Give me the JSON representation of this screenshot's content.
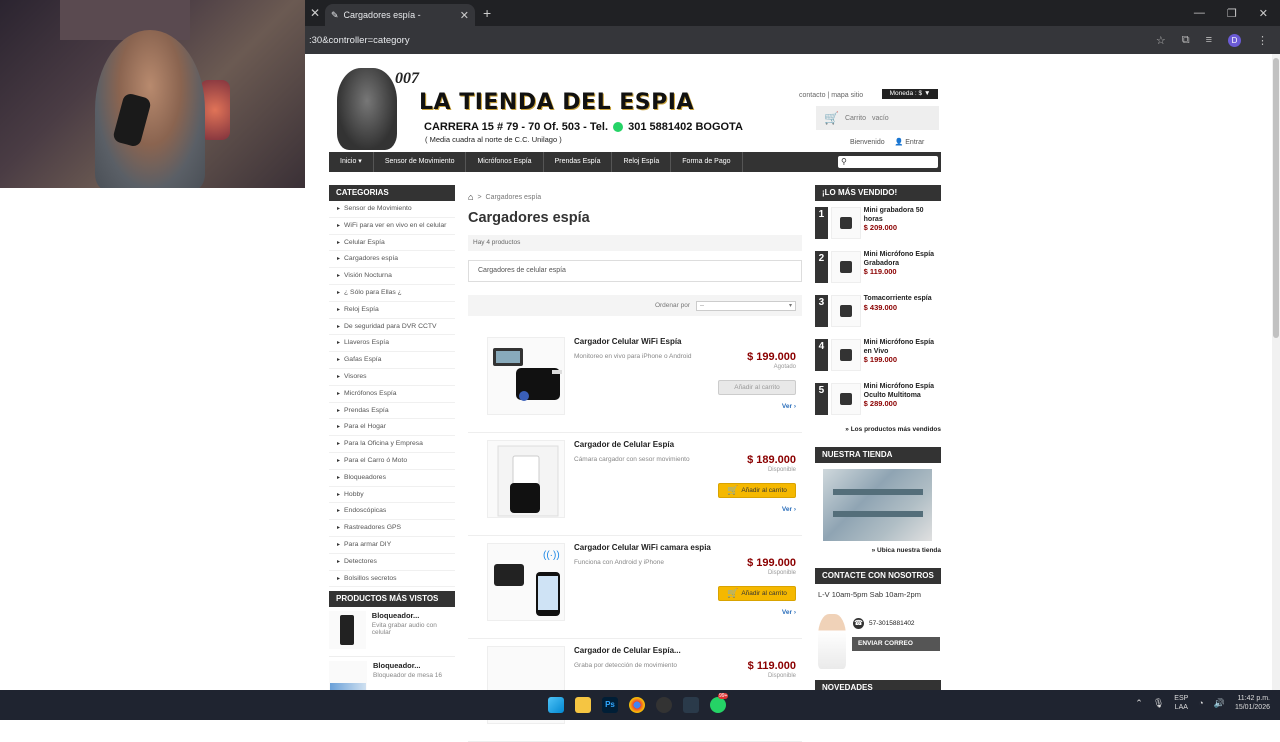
{
  "browser": {
    "tab_title": "Cargadores espía -",
    "url": ":30&controller=category",
    "profile_initial": "D"
  },
  "header": {
    "logo_007": "007",
    "logo_title": "LA TIENDA DEL ESPIA",
    "address_line": "CARRERA 15 # 79 - 70 Of. 503 - Tel.",
    "phone": "301 5881402",
    "city": "BOGOTA",
    "sub_line": "( Media cuadra al norte de C.C. Unilago )",
    "link_contact": "contacto",
    "link_sitemap": "mapa sitio",
    "currency": "Moneda : $ ▼",
    "cart_label": "Carrito",
    "cart_state": "vacío",
    "welcome": "Bienvenido",
    "login": "Entrar"
  },
  "nav": {
    "items": [
      "Inicio",
      "Sensor de Movimiento",
      "Micrófonos Espía",
      "Prendas Espía",
      "Reloj Espía",
      "Forma de Pago"
    ]
  },
  "left": {
    "categories_title": "CATEGORIAS",
    "categories": [
      "Sensor de Movimiento",
      "WiFi para ver en vivo en el celular",
      "Celular Espía",
      "Cargadores espía",
      "Visión Nocturna",
      "¿ Sólo para Ellas ¿",
      "Reloj Espía",
      "De seguridad para DVR CCTV",
      "Llaveros Espía",
      "Gafas Espía",
      "Visores",
      "Micrófonos Espía",
      "Prendas Espía",
      "Para el Hogar",
      "Para la Oficina y Empresa",
      "Para el Carro ó Moto",
      "Bloqueadores",
      "Hobby",
      "Endoscópicas",
      "Rastreadores GPS",
      "Para armar DIY",
      "Detectores",
      "Bolsillos secretos"
    ],
    "viewed_title": "PRODUCTOS MÁS VISTOS",
    "viewed": [
      {
        "name": "Bloqueador...",
        "desc": "Evita grabar audio con celular"
      },
      {
        "name": "Bloqueador...",
        "desc": "Bloqueador de mesa 16"
      }
    ]
  },
  "center": {
    "breadcrumb": "Cargadores espía",
    "title": "Cargadores espía",
    "count": "Hay 4 productos",
    "description": "Cargadores de celular espía",
    "sort_label": "Ordenar por",
    "sort_value": "--",
    "products": [
      {
        "name": "Cargador Celular WiFi Espía",
        "desc": "Monitoreo en vivo para iPhone o Android",
        "price": "$ 199.000",
        "stock": "Agotado",
        "button": "Añadir al carrito",
        "view": "Ver ›"
      },
      {
        "name": "Cargador de Celular Espía",
        "desc": "Cámara cargador con sesor movimiento",
        "price": "$ 189.000",
        "stock": "Disponible",
        "button": "Añadir al carrito",
        "view": "Ver ›"
      },
      {
        "name": "Cargador Celular WiFi camara espia",
        "desc": "Funciona con Android y iPhone",
        "price": "$ 199.000",
        "stock": "Disponible",
        "button": "Añadir al carrito",
        "view": "Ver ›"
      },
      {
        "name": "Cargador de Celular Espía...",
        "desc": "Graba por detección de movimiento",
        "price": "$ 119.000",
        "stock": "Disponible",
        "button": "",
        "view": ""
      }
    ]
  },
  "right": {
    "best_title": "¡LO MÁS VENDIDO!",
    "best": [
      {
        "num": "1",
        "name": "Mini grabadora 50 horas",
        "price": "$ 209.000"
      },
      {
        "num": "2",
        "name": "Mini Micrófono Espía Grabadora",
        "price": "$ 119.000"
      },
      {
        "num": "3",
        "name": "Tomacorriente espía",
        "price": "$ 439.000"
      },
      {
        "num": "4",
        "name": "Mini Micrófono Espía en Vivo",
        "price": "$ 199.000"
      },
      {
        "num": "5",
        "name": "Mini Micrófono Espía Oculto Multitoma",
        "price": "$ 289.000"
      }
    ],
    "best_more": "» Los productos más vendidos",
    "store_title": "NUESTRA TIENDA",
    "store_link": "» Ubica nuestra tienda",
    "contact_title": "CONTACTE CON NOSOTROS",
    "hours": "L-V 10am-5pm Sab 10am-2pm",
    "phone": "57-3015881402",
    "mail_button": "ENVIAR CORREO",
    "news_title": "NOVEDADES"
  },
  "taskbar": {
    "lang_top": "ESP",
    "lang_bottom": "LAA",
    "time": "11:42 p.m.",
    "date": "15/01/2026",
    "badge": "99+"
  }
}
